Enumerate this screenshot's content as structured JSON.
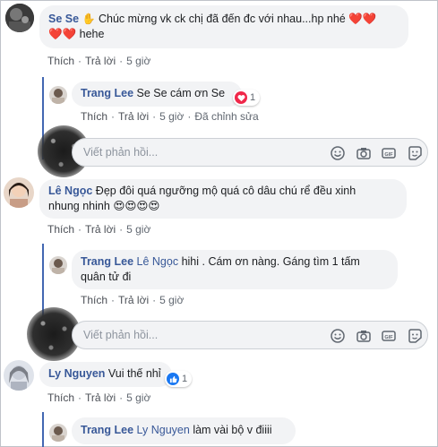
{
  "colors": {
    "link": "#385898",
    "thread": "#4267b2",
    "bubble": "#f2f3f5",
    "heart": "#f0284a",
    "like": "#1877f2"
  },
  "reply_placeholder": "Viết phản hồi...",
  "labels": {
    "like": "Thích",
    "reply": "Trả lời",
    "edited": "Đã chỉnh sửa"
  },
  "comments": [
    {
      "author": "Se Se",
      "text_line1": "Chúc mừng vk ck chị đã đến đc với nhau...hp nhé",
      "text_line2": "hehe",
      "time": "5 giờ",
      "reply": {
        "author": "Trang Lee",
        "text": "Se Se cám ơn Se",
        "reaction_count": "1",
        "reaction_icon": "heart-icon",
        "time": "5 giờ"
      }
    },
    {
      "author": "Lê Ngọc",
      "text_line1": "Đẹp đôi quá ngưỡng mộ quá cô dâu chú rể đều xinh",
      "text_line2": "nhung nhinh",
      "time": "5 giờ",
      "reply": {
        "author": "Trang Lee",
        "mention": "Lê Ngọc",
        "text_line1": "hihi . Cám ơn nàng. Gáng tìm 1 tấm",
        "text_line2": "quân tử đi",
        "time": "5 giờ"
      }
    },
    {
      "author": "Ly Nguyen",
      "text": "Vui thế nhỉ",
      "reaction_count": "1",
      "reaction_icon": "like-icon",
      "time": "5 giờ",
      "reply": {
        "author": "Trang Lee",
        "mention": "Ly Nguyen",
        "text": "làm vài bộ v điiii"
      }
    }
  ]
}
